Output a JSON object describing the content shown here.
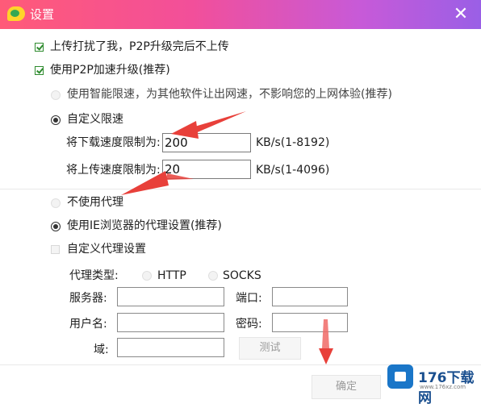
{
  "window": {
    "title": "设置",
    "close_glyph": "✕"
  },
  "options": {
    "no_upload_when_done": {
      "label": "上传打扰了我，P2P升级完后不上传",
      "checked": true
    },
    "p2p_accelerate": {
      "label": "使用P2P加速升级(推荐)",
      "checked": true
    },
    "smart_limit": {
      "label": "使用智能限速，为其他软件让出网速，不影响您的上网体验(推荐)",
      "selected": false
    },
    "custom_limit": {
      "label": "自定义限速",
      "selected": true
    },
    "download_limit": {
      "label": "将下载速度限制为:",
      "value": "200",
      "unit": "KB/s(1-8192)"
    },
    "upload_limit": {
      "label": "将上传速度限制为:",
      "value": "20",
      "unit": "KB/s(1-4096)"
    }
  },
  "proxy": {
    "no_proxy": {
      "label": "不使用代理",
      "selected": false
    },
    "ie_proxy": {
      "label": "使用IE浏览器的代理设置(推荐)",
      "selected": true
    },
    "custom_proxy": {
      "label": "自定义代理设置",
      "checked": false
    },
    "type_label": "代理类型:",
    "type_http": "HTTP",
    "type_socks": "SOCKS",
    "server_label": "服务器:",
    "server_value": "",
    "port_label": "端口:",
    "port_value": "",
    "username_label": "用户名:",
    "username_value": "",
    "password_label": "密码:",
    "password_value": "",
    "domain_label": "域:",
    "domain_value": "",
    "test_button": "测试"
  },
  "footer": {
    "ok_button": "确定"
  },
  "watermark": {
    "text": "176下载网",
    "sub": "www.176xz.com"
  },
  "colors": {
    "titlebar_start": "#ff5a78",
    "titlebar_end": "#9a5fe6",
    "check": "#2e8b2e",
    "arrow": "#e8403a"
  }
}
